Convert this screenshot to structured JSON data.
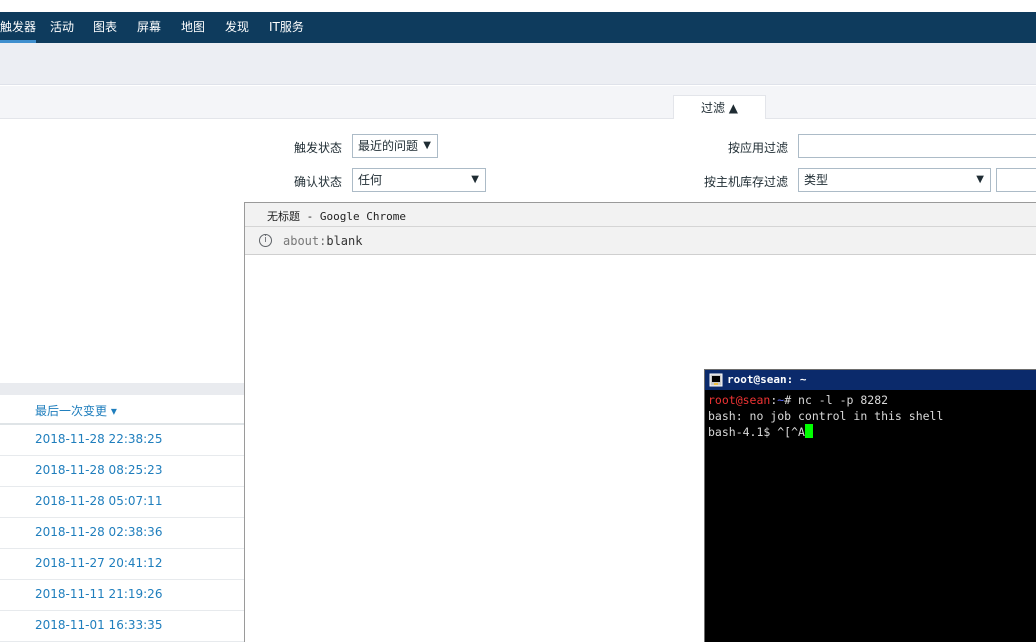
{
  "nav": {
    "items": [
      "触发器",
      "活动",
      "图表",
      "屏幕",
      "地图",
      "发现",
      "IT服务"
    ]
  },
  "filter": {
    "tab_label": "过滤 ▲",
    "trigger_state_label": "触发状态",
    "trigger_state_value": "最近的问题",
    "ack_state_label": "确认状态",
    "ack_state_value": "任何",
    "app_filter_label": "按应用过滤",
    "app_filter_value": "",
    "host_inventory_label": "按主机库存过滤",
    "host_inventory_type_value": "类型",
    "host_inventory_text_value": ""
  },
  "table": {
    "column_header": "最后一次变更 ▾",
    "rows": [
      "2018-11-28 22:38:25",
      "2018-11-28 08:25:23",
      "2018-11-28 05:07:11",
      "2018-11-28 02:38:36",
      "2018-11-27 20:41:12",
      "2018-11-11 21:19:26",
      "2018-11-01 16:33:35"
    ]
  },
  "chrome": {
    "window_title": "无标题 - Google Chrome",
    "url_scheme": "about:",
    "url_path": "blank"
  },
  "terminal": {
    "title": "root@sean: ~",
    "prompt_user": "root@sean",
    "prompt_sep": ":",
    "prompt_path": "~",
    "command": "# nc -l -p 8282",
    "line2": "bash: no job control in this shell",
    "line3": "bash-4.1$ ^[^A"
  }
}
